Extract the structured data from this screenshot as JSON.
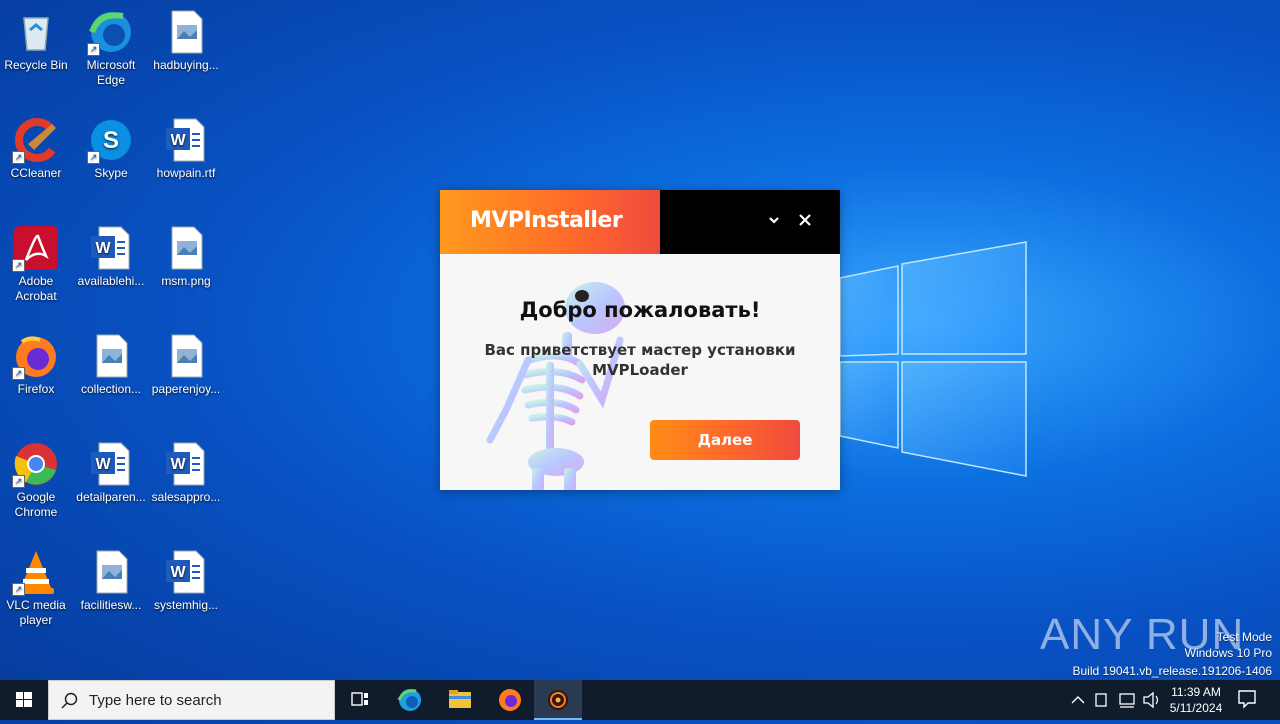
{
  "desktop": {
    "icons": [
      {
        "label": "Recycle Bin",
        "icon": "recycle-bin-icon"
      },
      {
        "label": "Microsoft Edge",
        "icon": "edge-icon"
      },
      {
        "label": "hadbuying...",
        "icon": "image-file-icon"
      },
      {
        "label": "CCleaner",
        "icon": "ccleaner-icon"
      },
      {
        "label": "Skype",
        "icon": "skype-icon"
      },
      {
        "label": "howpain.rtf",
        "icon": "word-doc-icon"
      },
      {
        "label": "Adobe Acrobat",
        "icon": "acrobat-icon"
      },
      {
        "label": "availablehi...",
        "icon": "word-doc-icon"
      },
      {
        "label": "msm.png",
        "icon": "image-file-icon"
      },
      {
        "label": "Firefox",
        "icon": "firefox-icon"
      },
      {
        "label": "collection...",
        "icon": "image-file-icon"
      },
      {
        "label": "paperenjoy...",
        "icon": "image-file-icon"
      },
      {
        "label": "Google Chrome",
        "icon": "chrome-icon"
      },
      {
        "label": "detailparen...",
        "icon": "word-doc-icon"
      },
      {
        "label": "salesappro...",
        "icon": "word-doc-icon"
      },
      {
        "label": "VLC media player",
        "icon": "vlc-icon"
      },
      {
        "label": "facilitiesw...",
        "icon": "image-file-icon"
      },
      {
        "label": "systemhig...",
        "icon": "word-doc-icon"
      }
    ]
  },
  "installer": {
    "brand": "MVPInstaller",
    "minimize_icon": "chevron-down-icon",
    "close_icon": "close-icon",
    "title": "Добро пожаловать!",
    "subtitle_line1": "Вас приветствует мастер установки",
    "subtitle_line2": "MVPLoader",
    "next_button": "Далее",
    "accent_start": "#ff9a1c",
    "accent_end": "#f04a3e"
  },
  "watermark": {
    "logo": "ANY RUN",
    "line1": "Test Mode",
    "line2": "Windows 10 Pro",
    "line3": "Build 19041.vb_release.191206-1406"
  },
  "taskbar": {
    "search_placeholder": "Type here to search",
    "apps": [
      "task-view-icon",
      "edge-icon",
      "file-explorer-icon",
      "firefox-icon",
      "installer-app-icon"
    ],
    "time": "11:39 AM",
    "date": "5/11/2024"
  }
}
